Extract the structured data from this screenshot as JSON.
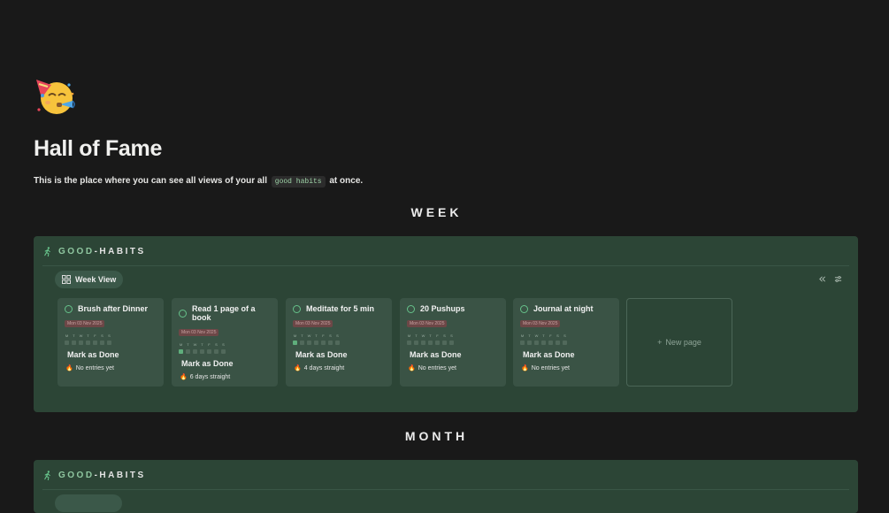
{
  "page": {
    "icon": "party-face-emoji",
    "title": "Hall of Fame",
    "desc_before": "This is the place where you can see all views of your all",
    "desc_code": "good habits",
    "desc_after": "at once."
  },
  "sections": {
    "week": {
      "heading": "WEEK",
      "db_title_a": "GOOD",
      "db_title_sep": "-",
      "db_title_b": "HABITS",
      "view_label": "Week View",
      "cards": [
        {
          "title": "Brush after Dinner",
          "date": "Mon 03 Nov 2025",
          "done": 0,
          "streak": "No entries yet"
        },
        {
          "title": "Read 1 page of a book",
          "date": "Mon 03 Nov 2025",
          "done": 1,
          "streak": "6 days straight"
        },
        {
          "title": "Meditate for 5 min",
          "date": "Mon 03 Nov 2025",
          "done": 1,
          "streak": "4 days straight"
        },
        {
          "title": "20 Pushups",
          "date": "Mon 03 Nov 2025",
          "done": 0,
          "streak": "No entries yet"
        },
        {
          "title": "Journal at night",
          "date": "Mon 03 Nov 2025",
          "done": 0,
          "streak": "No entries yet"
        }
      ],
      "days": [
        "M",
        "T",
        "W",
        "T",
        "F",
        "S",
        "S"
      ],
      "mark_label": "Mark as Done",
      "new_page_label": "New page",
      "new_page_icon": "+"
    },
    "month": {
      "heading": "MONTH",
      "db_title_a": "GOOD",
      "db_title_sep": "-",
      "db_title_b": "HABITS"
    }
  },
  "icons": {
    "database": "runner-icon",
    "view": "grid-icon",
    "collapse": "double-chevron-left-icon",
    "settings": "sliders-icon",
    "habit": "circle-icon",
    "streak": "flame-icon"
  },
  "colors": {
    "background": "#191919",
    "db_background": "#2c4536",
    "card": "#3a5345",
    "accent": "#66c28a",
    "date_tag": "#6d4747"
  }
}
